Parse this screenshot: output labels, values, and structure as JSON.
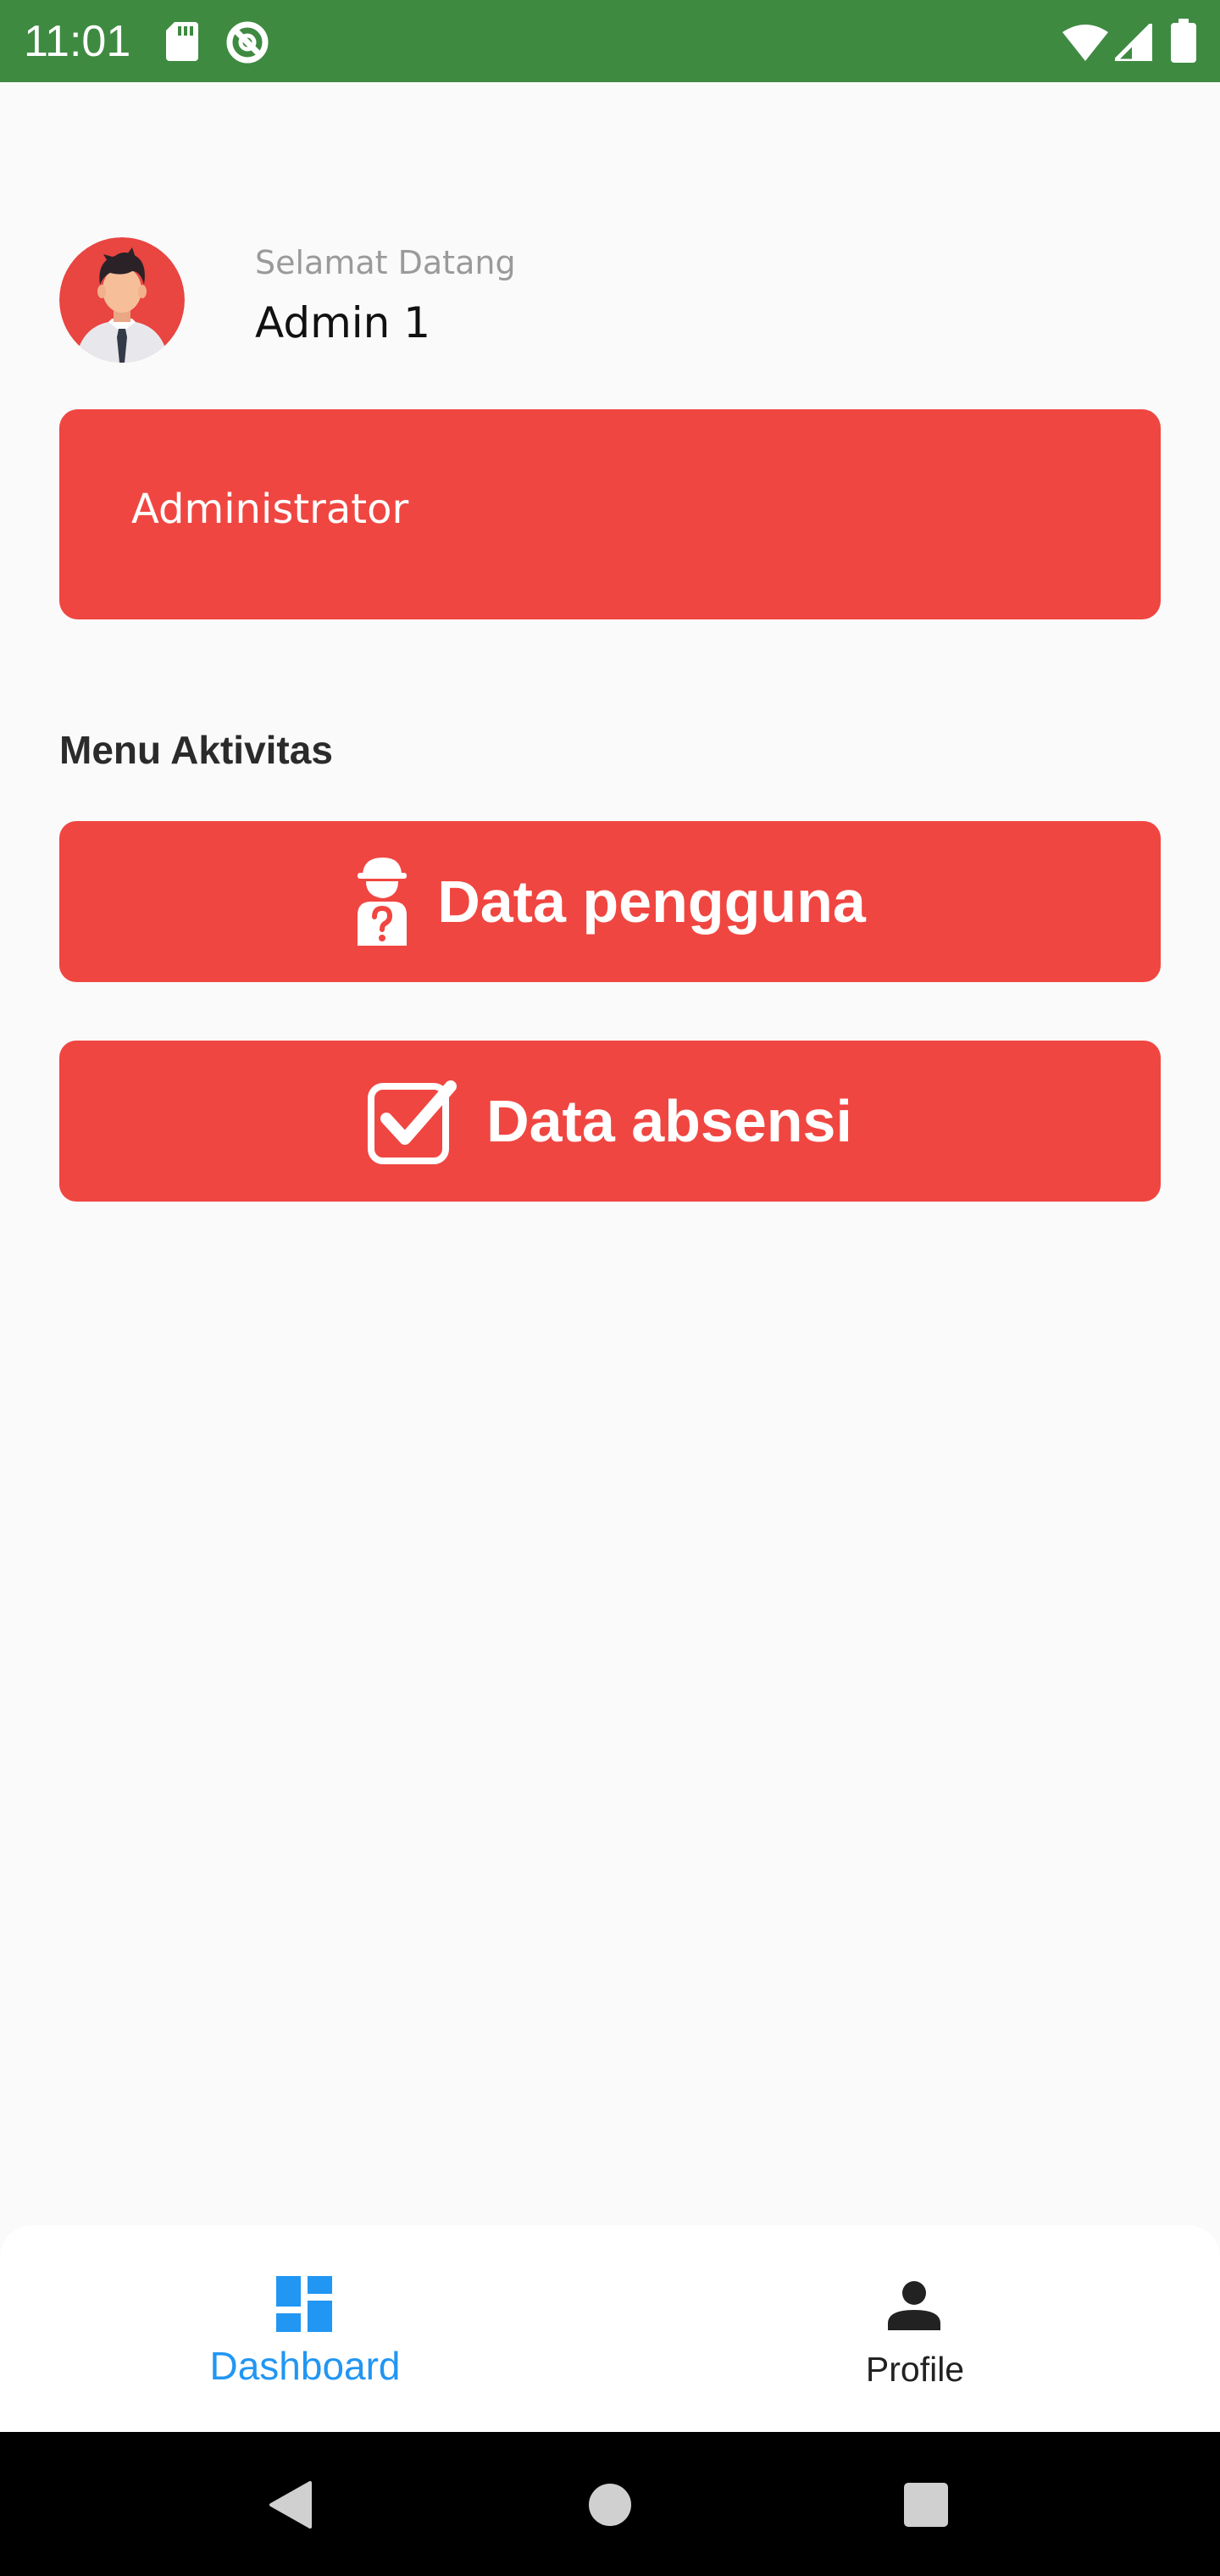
{
  "status_bar": {
    "time": "11:01",
    "background": "#3e8a41",
    "left_icons": [
      "sd-card-icon",
      "data-saver-icon"
    ],
    "right_icons": [
      "wifi-icon",
      "cell-signal-icon",
      "battery-icon"
    ]
  },
  "header": {
    "avatar_icon": "user-avatar",
    "greeting": "Selamat Datang",
    "username": "Admin 1"
  },
  "role_card": {
    "label": "Administrator"
  },
  "menu": {
    "title": "Menu Aktivitas",
    "items": [
      {
        "label": "Data pengguna",
        "icon": "user-question-icon"
      },
      {
        "label": "Data absensi",
        "icon": "checkbox-checked-icon"
      }
    ]
  },
  "bottom_nav": {
    "items": [
      {
        "label": "Dashboard",
        "icon": "dashboard-icon",
        "active": true
      },
      {
        "label": "Profile",
        "icon": "person-icon",
        "active": false
      }
    ]
  },
  "system_nav": {
    "buttons": [
      "back-icon",
      "home-icon",
      "recents-icon"
    ]
  },
  "colors": {
    "accent": "#f04641",
    "active_tab": "#2196f3",
    "status_bar": "#3e8a41",
    "background": "#fafafa"
  }
}
